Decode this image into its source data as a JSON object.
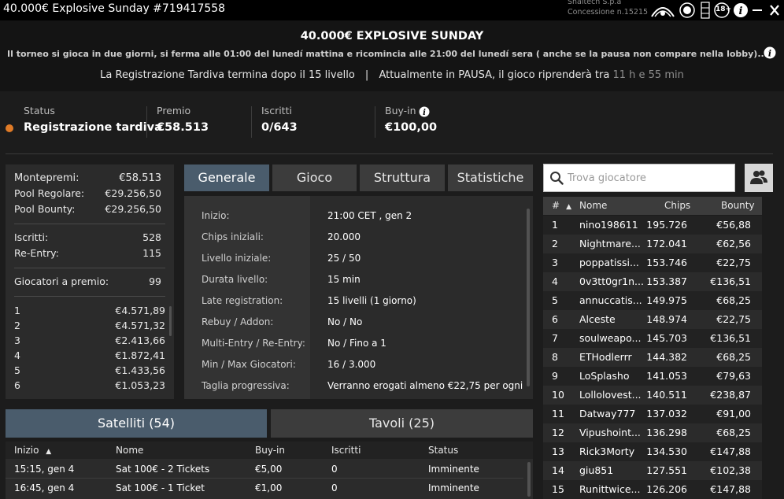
{
  "window": {
    "title": "40.000€ Explosive Sunday #719417558",
    "corp_line1": "Snaitech S.p.a",
    "corp_line2": "Concessione n.15215",
    "age_badge": "18+"
  },
  "header": {
    "title": "40.000€ EXPLOSIVE SUNDAY",
    "description": "Il torneo si gioca in due giorni, si ferma alle 01:00 del lunedí mattina e ricomincia alle 21:00 del lunedí sera ( anche se la pausa non compare nella lobby)....",
    "late_reg": "La Registrazione Tardiva termina dopo il 15 livello",
    "separator": "|",
    "paused": "Attualmente in PAUSA, il gioco riprenderà tra",
    "countdown": "11 h e 55 min"
  },
  "status": {
    "status_label": "Status",
    "status_value": "Registrazione tardiva",
    "status_color": "#e07b27",
    "prize_label": "Premio",
    "prize_value": "€58.513",
    "entrants_label": "Iscritti",
    "entrants_value": "0/643",
    "buyin_label": "Buy-in",
    "buyin_value": "€100,00"
  },
  "prizes": {
    "montepremi_label": "Montepremi:",
    "montepremi_value": "€58.513",
    "regular_label": "Pool Regolare:",
    "regular_value": "€29.256,50",
    "bounty_label": "Pool Bounty:",
    "bounty_value": "€29.256,50",
    "iscritti_label": "Iscritti:",
    "iscritti_value": "528",
    "reentry_label": "Re-Entry:",
    "reentry_value": "115",
    "paid_label": "Giocatori a premio:",
    "paid_value": "99",
    "places": [
      {
        "pos": "1",
        "amount": "€4.571,89"
      },
      {
        "pos": "2",
        "amount": "€4.571,32"
      },
      {
        "pos": "3",
        "amount": "€2.413,66"
      },
      {
        "pos": "4",
        "amount": "€1.872,41"
      },
      {
        "pos": "5",
        "amount": "€1.433,56"
      },
      {
        "pos": "6",
        "amount": "€1.053,23"
      }
    ]
  },
  "tabs": [
    "Generale",
    "Gioco",
    "Struttura",
    "Statistiche"
  ],
  "general": [
    {
      "label": "Inizio:",
      "value": "21:00 CET , gen 2"
    },
    {
      "label": "Chips iniziali:",
      "value": "20.000"
    },
    {
      "label": "Livello iniziale:",
      "value": "25 / 50"
    },
    {
      "label": "Durata livello:",
      "value": "15 min"
    },
    {
      "label": "Late registration:",
      "value": "15 livelli (1 giorno)"
    },
    {
      "label": "Rebuy / Addon:",
      "value": "No / No"
    },
    {
      "label": "Multi-Entry / Re-Entry:",
      "value": "No / Fino a 1"
    },
    {
      "label": "Min / Max Giocatori:",
      "value": "16 / 3.000"
    },
    {
      "label": "Taglia progressiva:",
      "value": "Verranno erogati almeno €22,75 per ogni"
    }
  ],
  "bottom_tabs": {
    "satellites": "Satelliti (54)",
    "tables": "Tavoli (25)"
  },
  "satellites": {
    "headers": [
      "Inizio",
      "Nome",
      "Buy-in",
      "Iscritti",
      "Status"
    ],
    "sort_arrow": "▲",
    "rows": [
      [
        "15:15, gen 4",
        "Sat 100€ - 2 Tickets",
        "€5,00",
        "0",
        "Imminente"
      ],
      [
        "16:45, gen 4",
        "Sat 100€ - 1 Ticket",
        "€1,00",
        "0",
        "Imminente"
      ]
    ]
  },
  "players": {
    "search_placeholder": "Trova giocatore",
    "headers": [
      "#",
      "Nome",
      "Chips",
      "Bounty"
    ],
    "sort_arrow": "▲",
    "rows": [
      [
        "1",
        "nino198611",
        "195.726",
        "€56,88"
      ],
      [
        "2",
        "Nightmare...",
        "172.041",
        "€62,56"
      ],
      [
        "3",
        "poppatissi...",
        "153.746",
        "€22,75"
      ],
      [
        "4",
        "0v3tt0gr1n...",
        "153.387",
        "€136,51"
      ],
      [
        "5",
        "annuccatis...",
        "149.975",
        "€68,25"
      ],
      [
        "6",
        "Alceste",
        "148.974",
        "€22,75"
      ],
      [
        "7",
        "soulweapo...",
        "145.703",
        "€136,51"
      ],
      [
        "8",
        "ETHodlerrr",
        "144.382",
        "€68,25"
      ],
      [
        "9",
        "LoSplasho",
        "141.053",
        "€79,63"
      ],
      [
        "10",
        "Lollolovest...",
        "140.511",
        "€238,87"
      ],
      [
        "11",
        "Datway777",
        "137.032",
        "€91,00"
      ],
      [
        "12",
        "Vipushoint...",
        "136.298",
        "€68,25"
      ],
      [
        "13",
        "Rick3Morty",
        "134.530",
        "€147,88"
      ],
      [
        "14",
        "giu851",
        "127.551",
        "€102,38"
      ],
      [
        "15",
        "Runittwice...",
        "126.206",
        "€147,88"
      ]
    ]
  }
}
